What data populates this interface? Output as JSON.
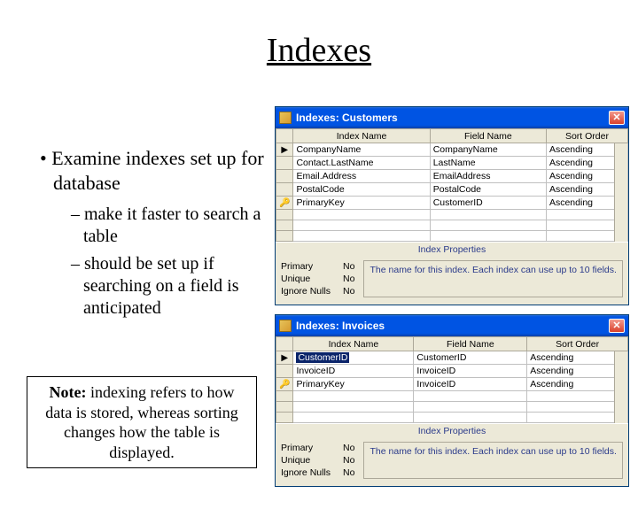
{
  "title": "Indexes",
  "bullets": {
    "main": "Examine indexes set up for database",
    "sub1": "make it faster to search a table",
    "sub2": "should be set up if searching on a field is anticipated"
  },
  "note": {
    "label": "Note:",
    "text": " indexing refers to how data is stored, whereas sorting changes how the table is displayed."
  },
  "dialog1": {
    "title": "Indexes: Customers",
    "headers": {
      "h1": "Index Name",
      "h2": "Field Name",
      "h3": "Sort Order"
    },
    "rows": [
      {
        "marker": "▶",
        "name": "CompanyName",
        "field": "CompanyName",
        "order": "Ascending"
      },
      {
        "marker": "",
        "name": "Contact.LastName",
        "field": "LastName",
        "order": "Ascending"
      },
      {
        "marker": "",
        "name": "Email.Address",
        "field": "EmailAddress",
        "order": "Ascending"
      },
      {
        "marker": "",
        "name": "PostalCode",
        "field": "PostalCode",
        "order": "Ascending"
      },
      {
        "marker": "🔑",
        "name": "PrimaryKey",
        "field": "CustomerID",
        "order": "Ascending"
      }
    ],
    "propsTitle": "Index Properties",
    "props": [
      {
        "label": "Primary",
        "value": "No"
      },
      {
        "label": "Unique",
        "value": "No"
      },
      {
        "label": "Ignore Nulls",
        "value": "No"
      }
    ],
    "help": "The name for this index. Each index can use up to 10 fields."
  },
  "dialog2": {
    "title": "Indexes: Invoices",
    "headers": {
      "h1": "Index Name",
      "h2": "Field Name",
      "h3": "Sort Order"
    },
    "rows": [
      {
        "marker": "▶",
        "name": "CustomerID",
        "selected": true,
        "field": "CustomerID",
        "order": "Ascending"
      },
      {
        "marker": "",
        "name": "InvoiceID",
        "field": "InvoiceID",
        "order": "Ascending"
      },
      {
        "marker": "🔑",
        "name": "PrimaryKey",
        "field": "InvoiceID",
        "order": "Ascending"
      }
    ],
    "propsTitle": "Index Properties",
    "props": [
      {
        "label": "Primary",
        "value": "No"
      },
      {
        "label": "Unique",
        "value": "No"
      },
      {
        "label": "Ignore Nulls",
        "value": "No"
      }
    ],
    "help": "The name for this index. Each index can use up to 10 fields."
  }
}
